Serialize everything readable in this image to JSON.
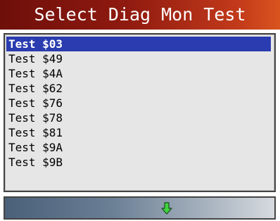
{
  "header": {
    "title": "Select Diag Mon Test"
  },
  "list": {
    "items": [
      {
        "label": "Test $03",
        "selected": true
      },
      {
        "label": "Test $49",
        "selected": false
      },
      {
        "label": "Test $4A",
        "selected": false
      },
      {
        "label": "Test $62",
        "selected": false
      },
      {
        "label": "Test $76",
        "selected": false
      },
      {
        "label": "Test $78",
        "selected": false
      },
      {
        "label": "Test $81",
        "selected": false
      },
      {
        "label": "Test $9A",
        "selected": false
      },
      {
        "label": "Test $9B",
        "selected": false
      }
    ]
  },
  "footer": {
    "scroll_icon": "green-down-arrow-icon",
    "arrow_color": "#3fd33f"
  },
  "colors": {
    "header_dark": "#6e0f0a",
    "header_light": "#d9541f",
    "selection": "#2a3caf",
    "list_bg": "#e6e6e6"
  }
}
